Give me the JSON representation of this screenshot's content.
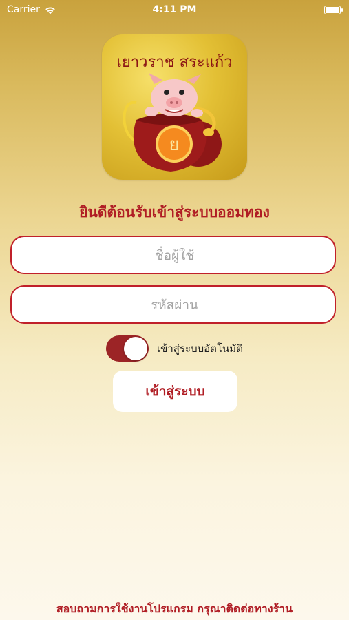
{
  "status_bar": {
    "carrier": "Carrier",
    "time": "4:11 PM"
  },
  "logo": {
    "text": "เยาวราช สระแก้ว",
    "coin_letter": "ย"
  },
  "welcome_text": "ยินดีต้อนรับเข้าสู่ระบบออมทอง",
  "username": {
    "placeholder": "ชื่อผู้ใช้",
    "value": ""
  },
  "password": {
    "placeholder": "รหัสผ่าน",
    "value": ""
  },
  "auto_login": {
    "label": "เข้าสู่ระบบอัตโนมัติ",
    "enabled": true
  },
  "login_button": "เข้าสู่ระบบ",
  "footer_text": "สอบถามการใช้งานโปรแกรม กรุณาติดต่อทางร้าน",
  "colors": {
    "accent": "#b01d24",
    "toggle_on": "#9c2426",
    "gold": "#d4af37"
  }
}
